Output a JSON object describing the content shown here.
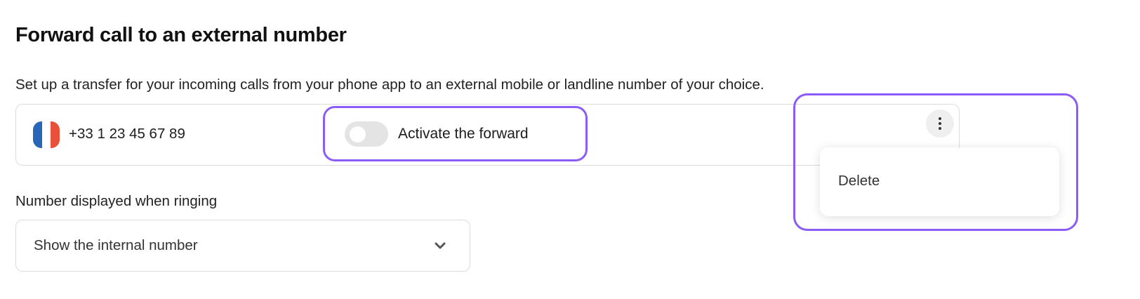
{
  "header": {
    "title": "Forward call to an external number",
    "description": "Set up a transfer for your incoming calls from your phone app to an external mobile or landline number of your choice."
  },
  "forward_number": {
    "flag_icon": "france-flag-icon",
    "phone": "+33 1 23 45 67 89",
    "toggle_label": "Activate the forward",
    "toggle_on": false,
    "more_icon": "more-vertical-icon"
  },
  "menu": {
    "items": [
      {
        "label": "Delete"
      }
    ]
  },
  "caller_display": {
    "label": "Number displayed when ringing",
    "selected": "Show the internal number",
    "chevron_icon": "chevron-down-icon"
  },
  "colors": {
    "highlight": "#8b5cf6",
    "flag_blue": "#2a66b8",
    "flag_red": "#e8503a"
  }
}
